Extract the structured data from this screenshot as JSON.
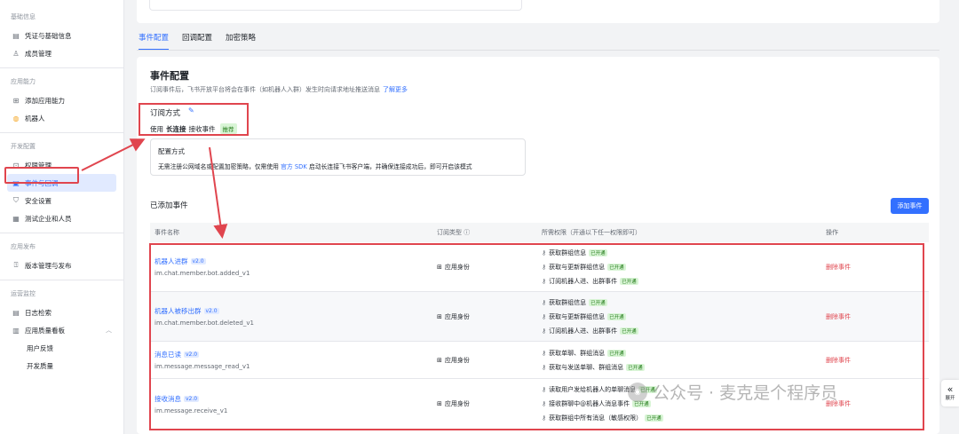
{
  "sidebar": {
    "sections": [
      {
        "heading": "基础信息",
        "items": [
          {
            "label": "凭证与基础信息",
            "icon": "doc-icon"
          },
          {
            "label": "成员管理",
            "icon": "user-icon"
          }
        ]
      },
      {
        "heading": "应用能力",
        "items": [
          {
            "label": "添加应用能力",
            "icon": "grid-icon"
          },
          {
            "label": "机器人",
            "icon": "robot-icon"
          }
        ]
      },
      {
        "heading": "开发配置",
        "items": [
          {
            "label": "权限管理",
            "icon": "lock-icon"
          },
          {
            "label": "事件与回调",
            "icon": "event-icon",
            "active": true
          },
          {
            "label": "安全设置",
            "icon": "shield-icon"
          },
          {
            "label": "测试企业和人员",
            "icon": "test-icon"
          }
        ]
      },
      {
        "heading": "应用发布",
        "items": [
          {
            "label": "版本管理与发布",
            "icon": "upload-icon"
          }
        ]
      },
      {
        "heading": "运营监控",
        "items": [
          {
            "label": "日志检索",
            "icon": "log-icon"
          },
          {
            "label": "应用质量看板",
            "icon": "chart-icon"
          },
          {
            "label": "用户反馈",
            "sub": true
          },
          {
            "label": "开发质量",
            "sub": true
          }
        ]
      }
    ]
  },
  "tabs": [
    "事件配置",
    "回调配置",
    "加密策略"
  ],
  "main": {
    "title": "事件配置",
    "desc": "订阅事件后，飞书开放平台将会在事件（如机器人入群）发生时向请求地址推送消息",
    "learn_more": "了解更多",
    "subscribe_label": "订阅方式",
    "subscribe_use": "使用",
    "subscribe_mode": "长连接",
    "subscribe_suffix": "接收事件",
    "recommended": "推荐",
    "config_title": "配置方式",
    "config_text_pre": "无需注册公网域名或配置加密策略，仅需使用",
    "config_link": "官方 SDK",
    "config_text_post": "启动长连接飞书客户端，并确保连接成功后，即可开启该模式",
    "added_title": "已添加事件",
    "add_button": "添加事件"
  },
  "table": {
    "headers": [
      "事件名称",
      "订阅类型 ⓘ",
      "所需权限（开通以下任一权限即可）",
      "操作"
    ],
    "rows": [
      {
        "name": "机器人进群",
        "version": "v2.0",
        "code": "im.chat.member.bot.added_v1",
        "type": "应用身份",
        "perms": [
          "获取群组信息",
          "获取与更新群组信息",
          "订阅机器人进、出群事件"
        ],
        "op": "删除事件"
      },
      {
        "name": "机器人被移出群",
        "version": "v2.0",
        "code": "im.chat.member.bot.deleted_v1",
        "type": "应用身份",
        "perms": [
          "获取群组信息",
          "获取与更新群组信息",
          "订阅机器人进、出群事件"
        ],
        "op": "删除事件"
      },
      {
        "name": "消息已读",
        "version": "v2.0",
        "code": "im.message.message_read_v1",
        "type": "应用身份",
        "perms": [
          "获取单聊、群组消息",
          "获取与发送单聊、群组消息"
        ],
        "op": "删除事件"
      },
      {
        "name": "接收消息",
        "version": "v2.0",
        "code": "im.message.receive_v1",
        "type": "应用身份",
        "perms": [
          "读取用户发给机器人的单聊消息",
          "接收群聊中@机器人消息事件",
          "获取群组中所有消息（敏感权限）"
        ],
        "op": "删除事件"
      }
    ],
    "opened_label": "已开通"
  },
  "expand_label": "展开",
  "watermark": "公众号 · 麦克是个程序员"
}
